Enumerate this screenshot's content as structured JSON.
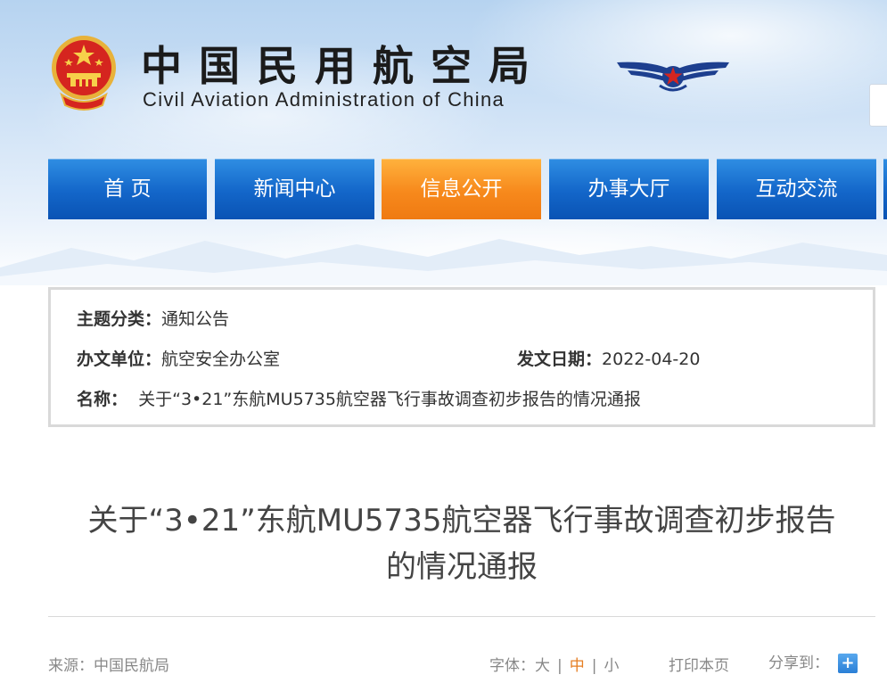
{
  "header": {
    "title_cn": "中国民用航空局",
    "title_en": "Civil Aviation Administration of China"
  },
  "nav": {
    "items": [
      {
        "label": "首 页"
      },
      {
        "label": "新闻中心"
      },
      {
        "label": "信息公开",
        "active": true
      },
      {
        "label": "办事大厅"
      },
      {
        "label": "互动交流"
      }
    ]
  },
  "info": {
    "category_label": "主题分类：",
    "category": "通知公告",
    "unit_label": "办文单位：",
    "unit": "航空安全办公室",
    "date_label": "发文日期：",
    "date": "2022-04-20",
    "name_label": "名称：",
    "name": "关于“3•21”东航MU5735航空器飞行事故调查初步报告的情况通报"
  },
  "article": {
    "title_line1": "关于“3•21”东航MU5735航空器飞行事故调查初步报告",
    "title_line2": "的情况通报"
  },
  "meta": {
    "source": "来源：中国民航局",
    "font_label": "字体：",
    "font_large": "大",
    "font_medium": "中",
    "font_small": "小",
    "print": "打印本页",
    "share": "分享到：",
    "share_icon": "+"
  },
  "colors": {
    "nav_blue": "#1366c9",
    "nav_active": "#f7891c",
    "font_active": "#e67e22"
  }
}
